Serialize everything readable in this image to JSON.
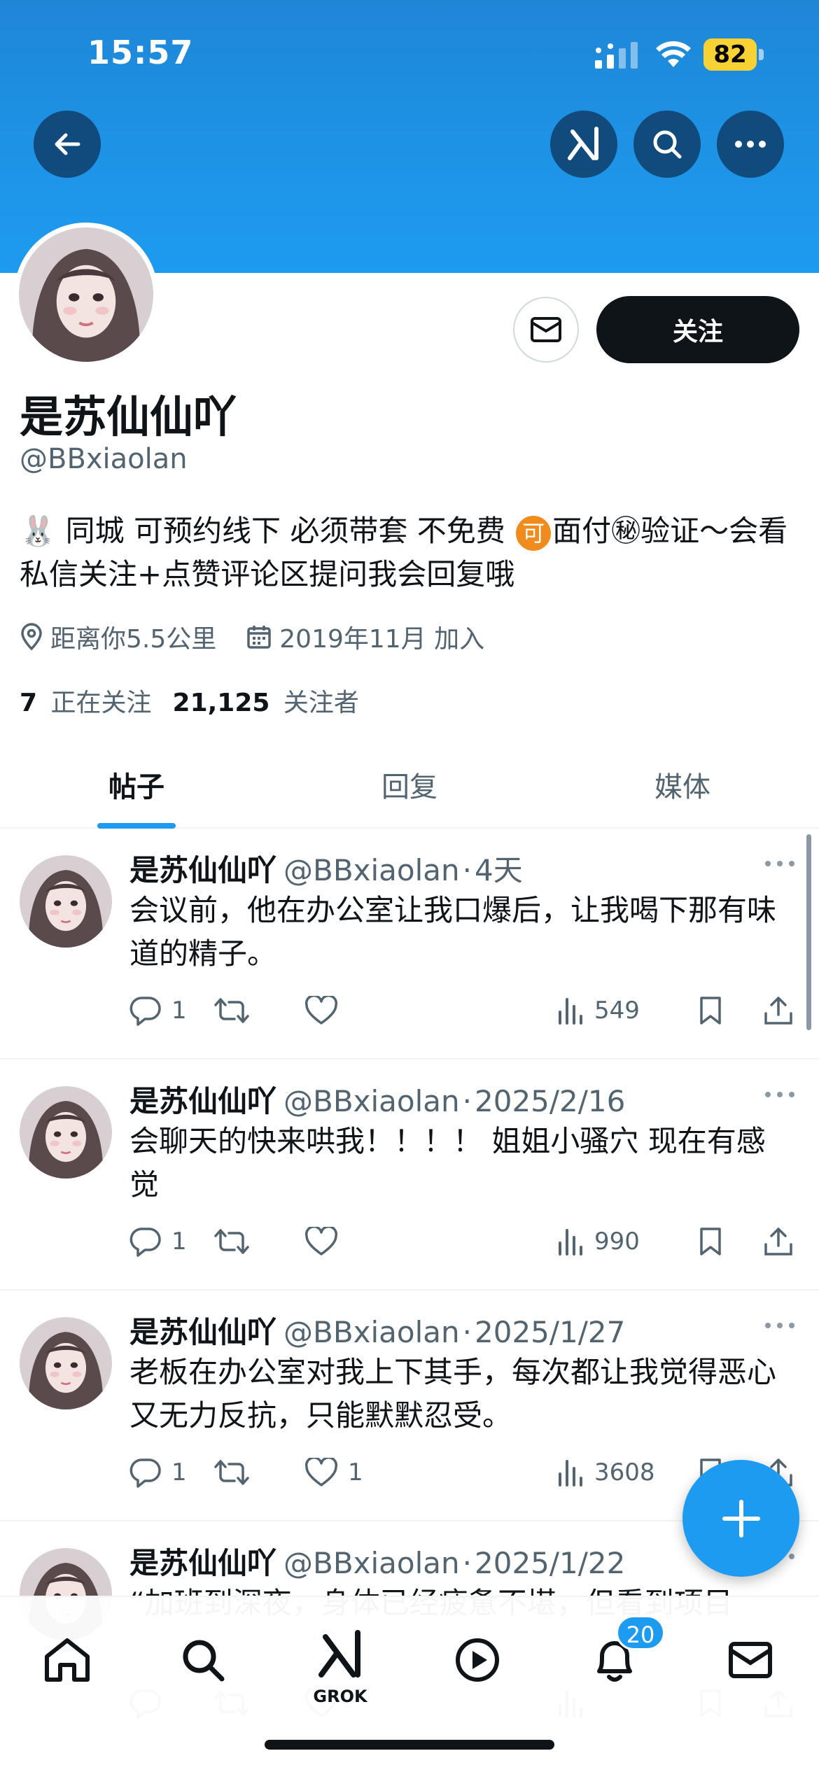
{
  "status_bar": {
    "time": "15:57",
    "battery": "82"
  },
  "profile": {
    "display_name": "是苏仙仙吖",
    "handle": "@BBxiaolan",
    "bio_emoji": "🐰",
    "bio_part1": "同城 可预约线下 必须带套 不免费",
    "bio_coin": "可",
    "bio_part2": "面付㊙验证～会看私信关注+点赞评论区提问我会回复哦",
    "location": "距离你5.5公里",
    "joined": "2019年11月 加入",
    "following_count": "7",
    "following_label": "正在关注",
    "followers_count": "21,125",
    "followers_label": "关注者",
    "follow_button": "关注"
  },
  "tabs": [
    {
      "label": "帖子",
      "active": true
    },
    {
      "label": "回复",
      "active": false
    },
    {
      "label": "媒体",
      "active": false
    }
  ],
  "posts": [
    {
      "name": "是苏仙仙吖",
      "handle": "@BBxiaolan",
      "time": "4天",
      "text": "会议前，他在办公室让我口爆后，让我喝下那有味道的精子。",
      "replies": "1",
      "reposts": "",
      "likes": "",
      "views": "549"
    },
    {
      "name": "是苏仙仙吖",
      "handle": "@BBxiaolan",
      "time": "2025/2/16",
      "text": "会聊天的快来哄我！！！！ 姐姐小骚穴 现在有感觉",
      "replies": "1",
      "reposts": "",
      "likes": "",
      "views": "990"
    },
    {
      "name": "是苏仙仙吖",
      "handle": "@BBxiaolan",
      "time": "2025/1/27",
      "text": "老板在办公室对我上下其手，每次都让我觉得恶心又无力反抗，只能默默忍受。",
      "replies": "1",
      "reposts": "",
      "likes": "1",
      "views": "3608"
    },
    {
      "name": "是苏仙仙吖",
      "handle": "@BBxiaolan",
      "time": "2025/1/22",
      "text": "“加班到深夜，身体已经疲惫不堪，但看到项目",
      "replies": "",
      "reposts": "",
      "likes": "",
      "views": ""
    }
  ],
  "bottom_nav": {
    "grok_label": "GROK",
    "notifications_badge": "20"
  },
  "colors": {
    "accent": "#1d9bf0",
    "text": "#0f1419",
    "muted": "#536471",
    "banner": "#1e93e6"
  }
}
